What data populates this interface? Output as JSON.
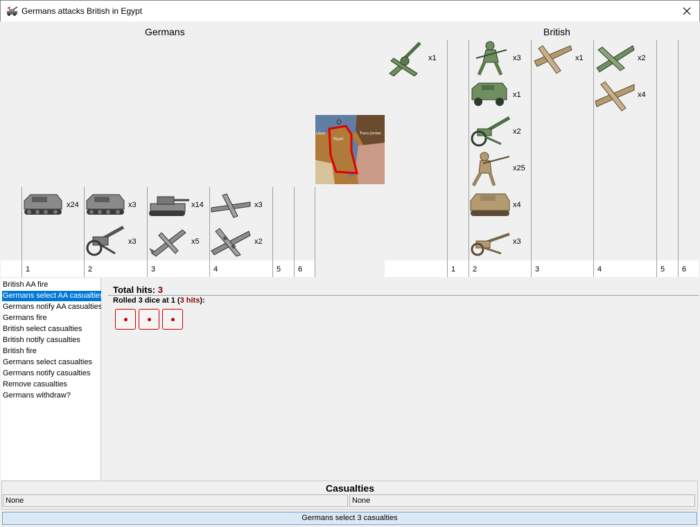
{
  "window": {
    "title": "Germans attacks British in Egypt",
    "app_icon": "tank-artillery-icon",
    "close_icon": "close-icon"
  },
  "sides": {
    "attacker": "Germans",
    "defender": "British"
  },
  "attacker_columns": [
    "1",
    "2",
    "3",
    "4",
    "5",
    "6"
  ],
  "defender_columns": [
    "1",
    "2",
    "3",
    "4",
    "5",
    "6"
  ],
  "attacker_units": {
    "col1": [
      {
        "icon": "halftrack-icon",
        "count": "x24"
      }
    ],
    "col2": [
      {
        "icon": "halftrack-icon",
        "count": "x3"
      },
      {
        "icon": "artillery-icon",
        "count": "x3"
      }
    ],
    "col3": [
      {
        "icon": "tank-icon",
        "count": "x14"
      },
      {
        "icon": "fighter-icon",
        "count": "x5"
      }
    ],
    "col4": [
      {
        "icon": "fighter-icon",
        "count": "x3"
      },
      {
        "icon": "bomber-icon",
        "count": "x2"
      }
    ]
  },
  "defender_units": {
    "col1": [
      {
        "icon": "aa-gun-icon",
        "count": "x1"
      }
    ],
    "col2": [
      {
        "icon": "infantry-icon",
        "count": "x3"
      },
      {
        "icon": "armored-car-icon",
        "count": "x1"
      },
      {
        "icon": "artillery-icon",
        "count": "x2"
      },
      {
        "icon": "infantry-icon",
        "count": "x25"
      },
      {
        "icon": "tank-icon",
        "count": "x4"
      },
      {
        "icon": "artillery-icon",
        "count": "x3"
      }
    ],
    "col3": [
      {
        "icon": "fighter-icon",
        "count": "x1"
      }
    ],
    "col4": [
      {
        "icon": "fighter-icon",
        "count": "x2"
      },
      {
        "icon": "fighter-icon",
        "count": "x4"
      }
    ]
  },
  "map_labels": {
    "territory": "Egypt",
    "neighbor_west": "Libya",
    "neighbor_east": "Trans-Jordan"
  },
  "steps": [
    "British AA fire",
    "Germans select AA casualties",
    "Germans notify AA casualties",
    "Germans fire",
    "British select casualties",
    "British notify casualties",
    "British fire",
    "Germans select casualties",
    "Germans notify casualties",
    "Remove casualties",
    "Germans withdraw?"
  ],
  "selected_step": 1,
  "results": {
    "total_label": "Total hits:",
    "total_value": "3",
    "rolled_prefix": "Rolled 3 dice at 1 (",
    "rolled_hits": "3 hits",
    "rolled_suffix": "):",
    "dice": [
      1,
      1,
      1
    ]
  },
  "casualties": {
    "title": "Casualties",
    "attacker": "None",
    "defender": "None"
  },
  "status": "Germans select 3 casualties",
  "colors": {
    "german": "#6b6b6b",
    "british_green": "#6f8f5f",
    "british_tan": "#b49a70",
    "hit_red": "#8b0000",
    "die_red": "#cc0000",
    "selection": "#0078d7"
  }
}
